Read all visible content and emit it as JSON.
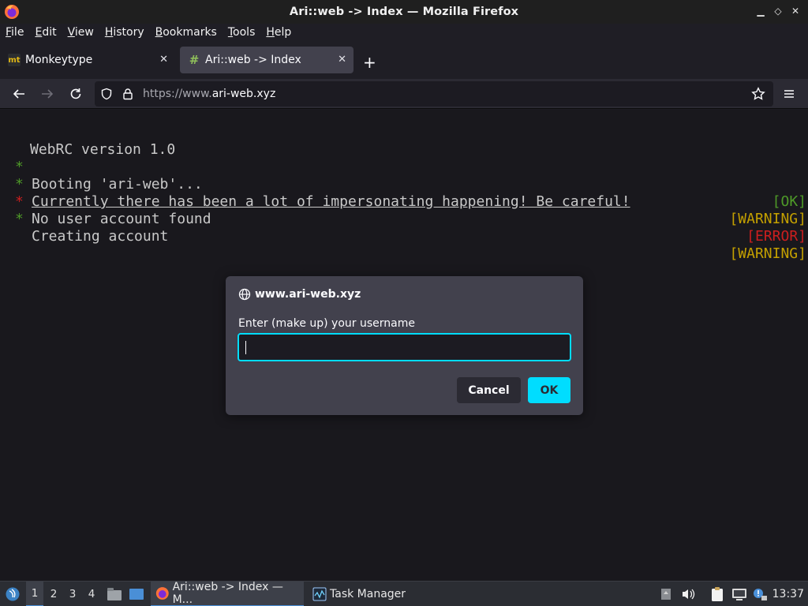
{
  "window": {
    "title": "Ari::web -> Index — Mozilla Firefox"
  },
  "menu": [
    "File",
    "Edit",
    "View",
    "History",
    "Bookmarks",
    "Tools",
    "Help"
  ],
  "tabs": [
    {
      "label": "Monkeytype",
      "favicon": "mt",
      "active": false
    },
    {
      "label": "Ari::web -> Index",
      "favicon": "#",
      "active": true
    }
  ],
  "urlbar": {
    "prefix": "https://www.",
    "domain": "ari-web.xyz"
  },
  "terminal": {
    "header": "WebRC version 1.0",
    "lines": [
      {
        "bullet": "*",
        "text": "Booting 'ari-web'...",
        "status": "[OK]",
        "status_color": "#4e9a28"
      },
      {
        "bullet": "*",
        "text": "Currently there has been a lot of impersonating happening! Be careful!",
        "status": "[WARNING]",
        "status_color": "#c4a000"
      },
      {
        "bullet": "*",
        "text": "No user account found",
        "status": "[ERROR]",
        "status_color": "#cc1e1e"
      },
      {
        "bullet": "*",
        "text": "Creating account",
        "status": "[WARNING]",
        "status_color": "#c4a000"
      }
    ]
  },
  "dialog": {
    "title": "www.ari-web.xyz",
    "prompt": "Enter (make up) your username",
    "input_value": "",
    "cancel_label": "Cancel",
    "ok_label": "OK"
  },
  "taskbar": {
    "workspaces": [
      "1",
      "2",
      "3",
      "4"
    ],
    "tasks": [
      {
        "label": "Ari::web -> Index — M...",
        "icon": "firefox-icon"
      },
      {
        "label": "Task Manager",
        "icon": "task-manager-icon"
      }
    ],
    "clock": "13:37"
  },
  "colors": {
    "accent": "#00ddff",
    "ok": "#4e9a28",
    "warning": "#c4a000",
    "error": "#cc1e1e"
  }
}
